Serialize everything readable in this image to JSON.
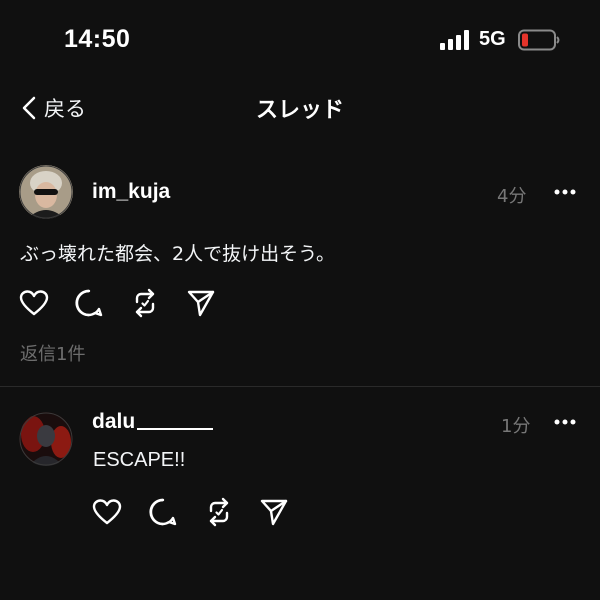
{
  "status_bar": {
    "time": "14:50",
    "network": "5G",
    "signal_icon": "cellular-signal-icon",
    "battery_icon": "battery-low-icon",
    "battery_color": "#e5342b"
  },
  "nav": {
    "back_label": "戻る",
    "title": "スレッド"
  },
  "posts": [
    {
      "username": "im_kuja",
      "time_ago": "4分",
      "text": "ぶっ壊れた都会、2人で抜け出そう。",
      "replies": "返信1件",
      "actions": [
        "heart-icon",
        "comment-icon",
        "repost-icon",
        "share-icon"
      ]
    },
    {
      "username": "dalu",
      "time_ago": "1分",
      "text": "ESCAPE!!",
      "actions": [
        "heart-icon",
        "comment-icon",
        "repost-icon",
        "share-icon"
      ]
    }
  ],
  "colors": {
    "background": "#101010",
    "text": "#f3f5f7",
    "secondary_text": "#777777",
    "divider": "#2a2a2a"
  }
}
